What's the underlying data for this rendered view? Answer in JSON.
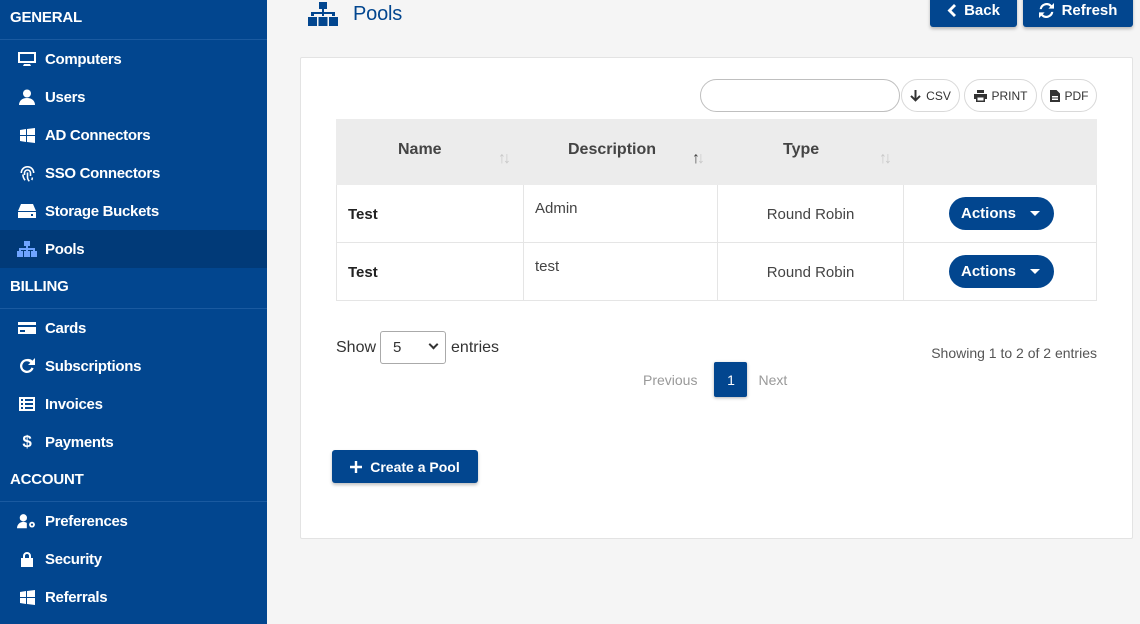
{
  "sidebar": {
    "sections": [
      {
        "title": "GENERAL",
        "items": [
          {
            "label": "Computers",
            "icon": "monitor-icon"
          },
          {
            "label": "Users",
            "icon": "user-icon"
          },
          {
            "label": "AD Connectors",
            "icon": "windows-icon"
          },
          {
            "label": "SSO Connectors",
            "icon": "fingerprint-icon"
          },
          {
            "label": "Storage Buckets",
            "icon": "storage-icon"
          },
          {
            "label": "Pools",
            "icon": "sitemap-icon",
            "active": true
          }
        ]
      },
      {
        "title": "BILLING",
        "items": [
          {
            "label": "Cards",
            "icon": "credit-card-icon"
          },
          {
            "label": "Subscriptions",
            "icon": "redo-icon"
          },
          {
            "label": "Invoices",
            "icon": "list-icon"
          },
          {
            "label": "Payments",
            "icon": "dollar-icon"
          }
        ]
      },
      {
        "title": "ACCOUNT",
        "items": [
          {
            "label": "Preferences",
            "icon": "user-cog-icon"
          },
          {
            "label": "Security",
            "icon": "lock-icon"
          },
          {
            "label": "Referrals",
            "icon": "windows-icon"
          }
        ]
      }
    ]
  },
  "header": {
    "title": "Pools",
    "back_label": "Back",
    "refresh_label": "Refresh"
  },
  "toolbar": {
    "search_value": "",
    "csv_label": "CSV",
    "print_label": "PRINT",
    "pdf_label": "PDF"
  },
  "table": {
    "columns": [
      "Name",
      "Description",
      "Type"
    ],
    "rows": [
      {
        "name": "Test",
        "description": "Admin",
        "type": "Round Robin",
        "action_label": "Actions"
      },
      {
        "name": "Test",
        "description": "test",
        "type": "Round Robin",
        "action_label": "Actions"
      }
    ]
  },
  "footer": {
    "show_label": "Show",
    "entries_value": "5",
    "entries_label": "entries",
    "info": "Showing 1 to 2 of 2 entries",
    "prev_label": "Previous",
    "page": "1",
    "next_label": "Next",
    "create_label": "Create a Pool"
  },
  "colors": {
    "primary": "#02468f",
    "sidebar_active": "#013a78",
    "active_icon": "#6fa4ff"
  }
}
